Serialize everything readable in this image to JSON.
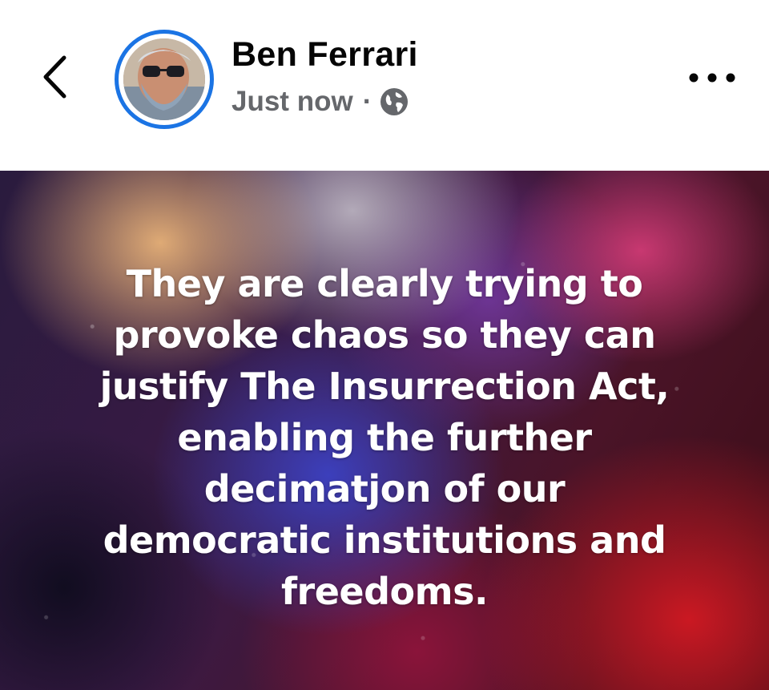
{
  "post": {
    "author_name": "Ben Ferrari",
    "timestamp": "Just now",
    "separator": "·",
    "audience_icon": "globe-icon",
    "text_lines": [
      "They are clearly trying to",
      "provoke chaos so they can",
      "justify The Insurrection Act,",
      "enabling the further",
      "decimatjon of our",
      "democratic institutions and",
      "freedoms."
    ]
  },
  "nav": {
    "back_icon": "chevron-left-icon",
    "more_icon": "more-horizontal-icon"
  },
  "colors": {
    "avatar_ring": "#1b74e4",
    "name_text": "#050505",
    "meta_text": "#65676b",
    "post_text": "#ffffff"
  }
}
